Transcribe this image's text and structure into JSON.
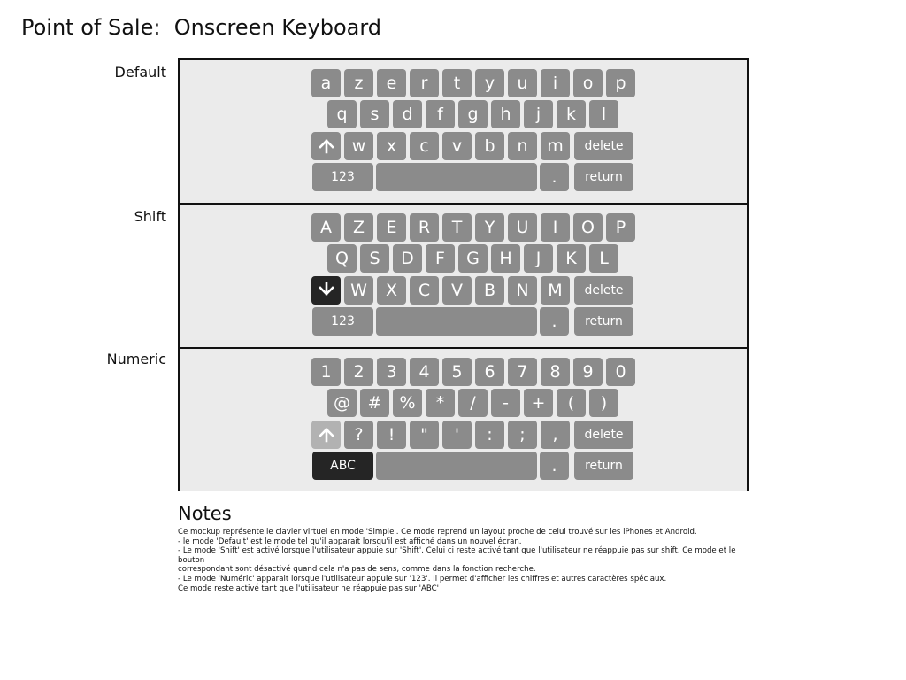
{
  "page": {
    "title": "Point of Sale:  Onscreen Keyboard"
  },
  "labels": {
    "default": "Default",
    "shift": "Shift",
    "numeric": "Numeric"
  },
  "icons": {
    "shift_up": "shift-up-arrow-icon",
    "shift_down": "shift-down-arrow-icon"
  },
  "colors": {
    "key": "#8b8b8b",
    "key_active": "#252525",
    "key_disabled": "#b2b2b2",
    "panel_bg": "#ebebeb"
  },
  "keyboards": {
    "default": {
      "row1": [
        "a",
        "z",
        "e",
        "r",
        "t",
        "y",
        "u",
        "i",
        "o",
        "p"
      ],
      "row2": [
        "q",
        "s",
        "d",
        "f",
        "g",
        "h",
        "j",
        "k",
        "l"
      ],
      "row3": [
        "w",
        "x",
        "c",
        "v",
        "b",
        "n",
        "m"
      ],
      "delete": "delete",
      "mode": "123",
      "period": ".",
      "return": "return"
    },
    "shift": {
      "row1": [
        "A",
        "Z",
        "E",
        "R",
        "T",
        "Y",
        "U",
        "I",
        "O",
        "P"
      ],
      "row2": [
        "Q",
        "S",
        "D",
        "F",
        "G",
        "H",
        "J",
        "K",
        "L"
      ],
      "row3": [
        "W",
        "X",
        "C",
        "V",
        "B",
        "N",
        "M"
      ],
      "delete": "delete",
      "mode": "123",
      "period": ".",
      "return": "return"
    },
    "numeric": {
      "row1": [
        "1",
        "2",
        "3",
        "4",
        "5",
        "6",
        "7",
        "8",
        "9",
        "0"
      ],
      "row2": [
        "@",
        "#",
        "%",
        "*",
        "/",
        "-",
        "+",
        "(",
        ")"
      ],
      "row3": [
        "?",
        "!",
        "\"",
        "'",
        ":",
        ";",
        ","
      ],
      "delete": "delete",
      "mode": "ABC",
      "period": ".",
      "return": "return"
    }
  },
  "notes": {
    "title": "Notes",
    "lines": [
      "Ce mockup représente le clavier virtuel en mode 'Simple'. Ce mode reprend un layout proche de celui trouvé sur les iPhones et Android.",
      "- le mode 'Default' est le mode tel qu'il apparait lorsqu'il est affiché dans un nouvel écran.",
      "- Le mode 'Shift' est activé lorsque l'utilisateur appuie sur 'Shift'. Celui ci reste activé tant que l'utilisateur ne réappuie pas sur shift. Ce mode et le bouton",
      "correspondant sont désactivé quand cela n'a pas de sens, comme dans la fonction recherche.",
      "- Le mode 'Numéric' apparait lorsque l'utilisateur appuie sur '123'. Il permet d'afficher les chiffres et autres caractères spéciaux.",
      "Ce mode reste activé tant que l'utilisateur ne réappuie pas sur 'ABC'"
    ]
  }
}
